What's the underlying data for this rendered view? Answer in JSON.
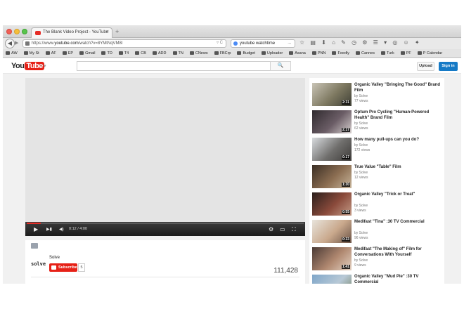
{
  "browser": {
    "tab_title": "The Blank Video Project - YouTube",
    "tab_close": "×",
    "new_tab": "+",
    "url_prefix": "https://www.",
    "url_domain": "youtube.com",
    "url_path": "/watch?v=8YMtNqVM8I",
    "url_icons": "▿ C",
    "search_value": "youtube watchtime",
    "search_go": "→",
    "toolbar_icons": "☆ ▤ ⬇ ⌂ ✎ ◷ ⚙ ☰ ▾ ◎ ☺ ✦"
  },
  "bookmarks": [
    "AW",
    "My St",
    "AF",
    "EP",
    "Gmail",
    "TD",
    "T4",
    "CB",
    "ADD",
    "TN",
    "CNews",
    "FBCrp",
    "Budget",
    "Uploader",
    "Asana",
    "PNN",
    "Feedly",
    "Cannes",
    "Turk",
    "PF",
    "P Calendar"
  ],
  "youtube": {
    "logo_you": "You",
    "logo_tube": "Tube",
    "guide_glyph": "≡ ▾",
    "search_placeholder": "",
    "search_button": "🔍",
    "upload_label": "Upload",
    "signin_label": "Sign in"
  },
  "player": {
    "time": "0:12 / 4:00",
    "progress": 0.05,
    "play_glyph": "▶",
    "next_glyph": "▶▮",
    "volume_glyph": "◀)",
    "settings_glyph": "⚙",
    "theater_glyph": "▭",
    "fullscreen_glyph": "⛶"
  },
  "video_info": {
    "channel_logo": "solve",
    "channel_name": "Solve",
    "subscribe_label": "Subscribe",
    "subscriber_count": "5",
    "view_count": "111,428"
  },
  "recommendations": [
    {
      "title": "Organic Valley \"Bringing The Good\" Brand Film",
      "channel": "by Solve",
      "views": "77 views",
      "duration": "2:31",
      "colors": [
        "#c9c4b6",
        "#7d7860",
        "#3f4036"
      ]
    },
    {
      "title": "Optum Pro Cycling \"Human-Powered Health\" Brand Film",
      "channel": "by Solve",
      "views": "62 views",
      "duration": "2:17",
      "colors": [
        "#2f2a2e",
        "#6b5d66",
        "#d7d0cf"
      ]
    },
    {
      "title": "How many pull-ups can you do?",
      "channel": "by Solve",
      "views": "172 views",
      "duration": "0:17",
      "colors": [
        "#d9dcdf",
        "#6f6e6c",
        "#3d3b39"
      ]
    },
    {
      "title": "True Value \"Table\" Film",
      "channel": "by Solve",
      "views": "12 views",
      "duration": "1:30",
      "colors": [
        "#3b2f25",
        "#8c6e52",
        "#c7b59b"
      ]
    },
    {
      "title": "Organic Valley \"Trick or Treat\"",
      "channel": "by Solve",
      "views": "3 views",
      "duration": "0:55",
      "colors": [
        "#2a1f1c",
        "#8a4a3b",
        "#c39a86"
      ]
    },
    {
      "title": "Medifast \"Tina\" :30 TV Commercial",
      "channel": "by Solve",
      "views": "96 views",
      "duration": "0:33",
      "colors": [
        "#e8e4dc",
        "#c9a88c",
        "#6b5346"
      ]
    },
    {
      "title": "Medifast \"The Making of\" Film for Conversations With Yourself",
      "channel": "by Solve",
      "views": "9 views",
      "duration": "1:41",
      "colors": [
        "#4a3a35",
        "#b08870",
        "#e4d2c2"
      ]
    },
    {
      "title": "Organic Valley \"Mud Pie\" :30 TV Commercial",
      "channel": "by Solve",
      "views": "",
      "duration": "",
      "colors": [
        "#7fa6c9",
        "#b8c9d6",
        "#6d7b5a"
      ]
    }
  ]
}
